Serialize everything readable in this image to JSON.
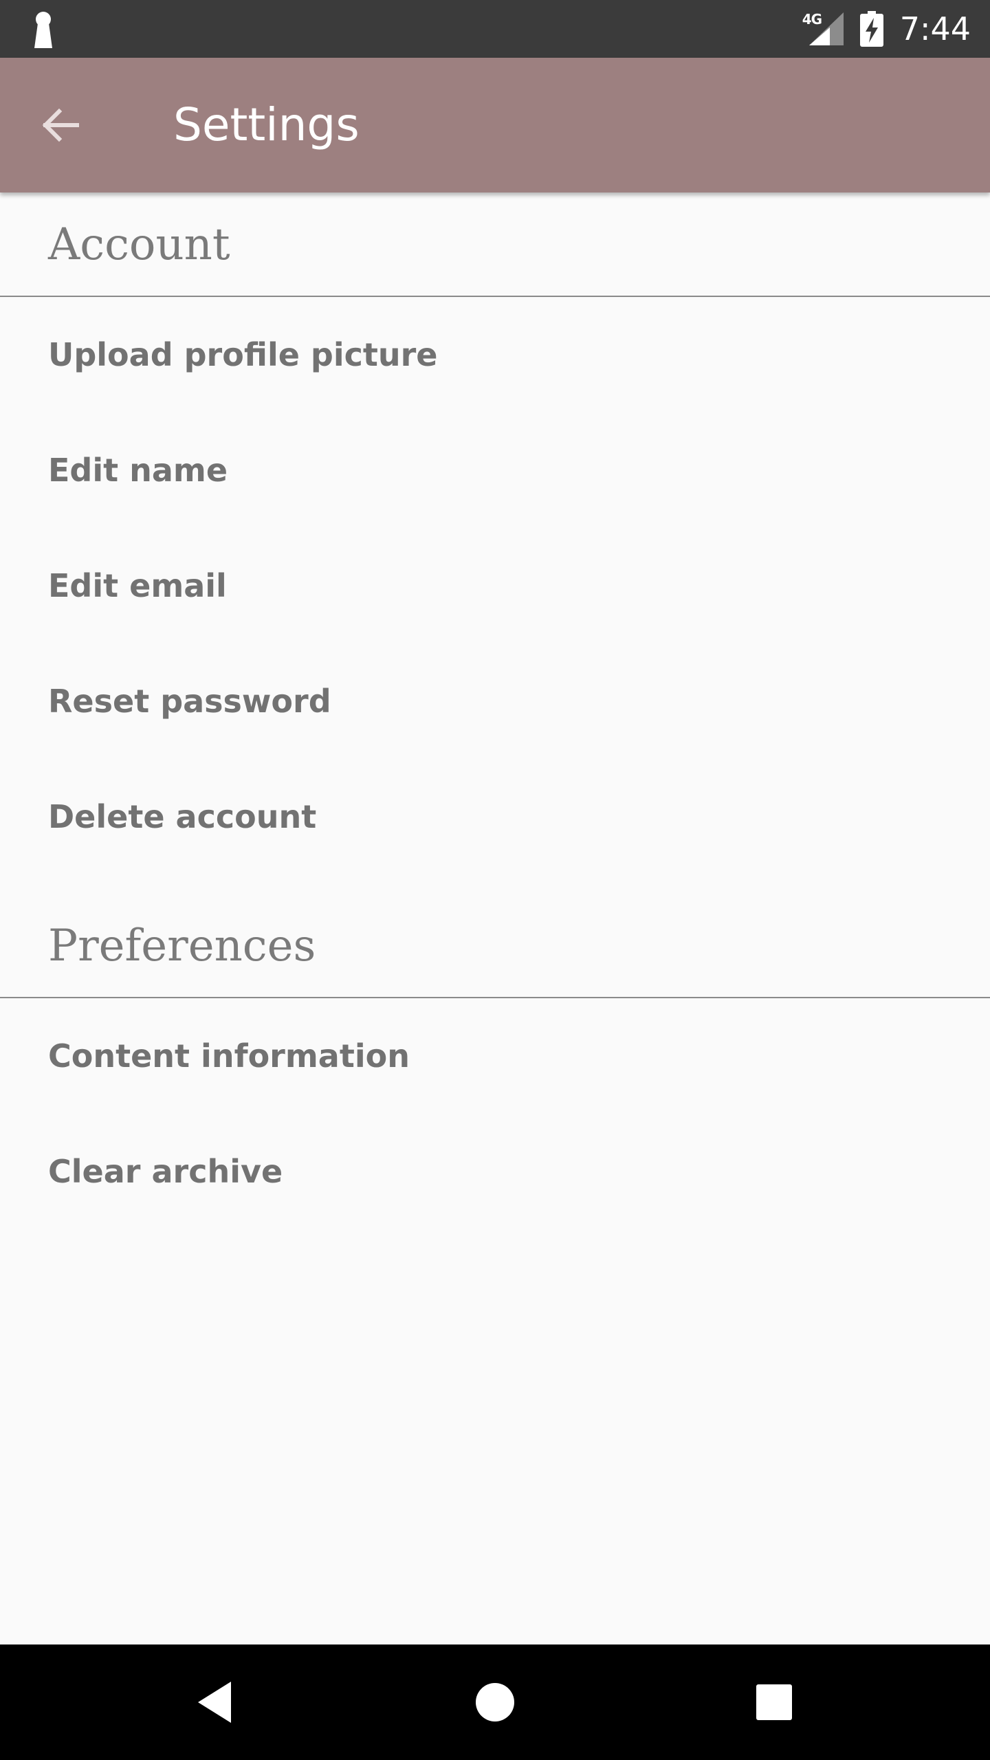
{
  "status_bar": {
    "time": "7:44",
    "network": "4G",
    "left_icon": "keyhole-icon",
    "signal_icon": "signal-icon",
    "battery_icon": "battery-charging-icon"
  },
  "app_bar": {
    "title": "Settings",
    "back_icon": "arrow-back-icon",
    "color": "#9d8080"
  },
  "sections": [
    {
      "title": "Account",
      "items": [
        {
          "label": "Upload profile picture"
        },
        {
          "label": "Edit name"
        },
        {
          "label": "Edit email"
        },
        {
          "label": "Reset password"
        },
        {
          "label": "Delete account"
        }
      ]
    },
    {
      "title": "Preferences",
      "items": [
        {
          "label": "Content information"
        },
        {
          "label": "Clear archive"
        }
      ]
    }
  ],
  "nav_bar": {
    "back_icon": "nav-back-triangle-icon",
    "home_icon": "nav-home-circle-icon",
    "recent_icon": "nav-recents-square-icon"
  }
}
